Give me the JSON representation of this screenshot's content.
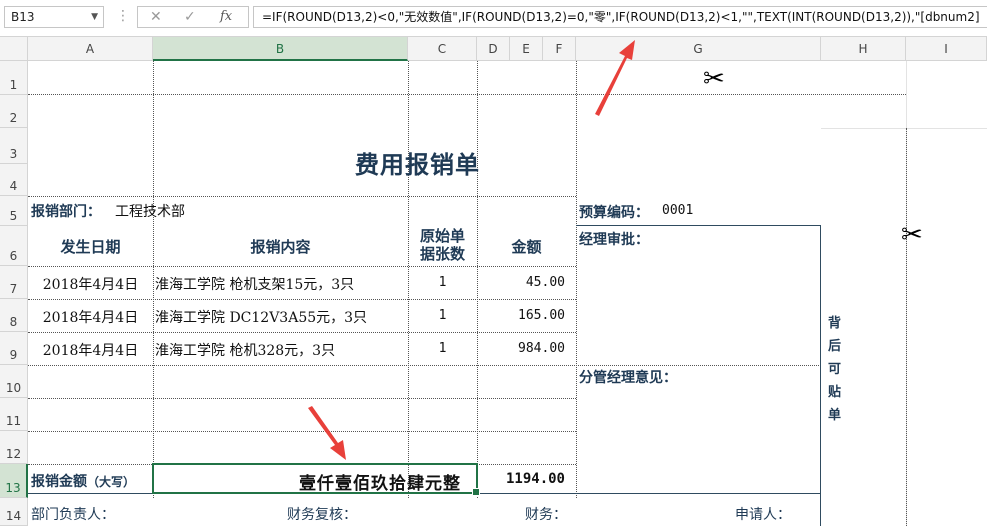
{
  "formula_bar": {
    "name_box": "B13",
    "cancel_icon": "✕",
    "enter_icon": "✓",
    "fx_label": "fx",
    "formula": "=IF(ROUND(D13,2)<0,\"无效数值\",IF(ROUND(D13,2)=0,\"零\",IF(ROUND(D13,2)<1,\"\",TEXT(INT(ROUND(D13,2)),\"[dbnum2]"
  },
  "columns": [
    "A",
    "B",
    "C",
    "D",
    "E",
    "F",
    "G",
    "H",
    "I"
  ],
  "rows": [
    "1",
    "2",
    "3",
    "4",
    "5",
    "6",
    "7",
    "8",
    "9",
    "10",
    "11",
    "12",
    "13",
    "14"
  ],
  "form": {
    "title": "费用报销单",
    "department_label": "报销部门：",
    "department_value": "工程技术部",
    "budget_label": "预算编码：",
    "budget_value": "0001",
    "headers": {
      "date": "发生日期",
      "content": "报销内容",
      "docs_line1": "原始单",
      "docs_line2": "据张数",
      "amount": "金额"
    },
    "items": [
      {
        "date": "2018年4月4日",
        "content": "淮海工学院 枪机支架15元，3只",
        "docs": "1",
        "amount": "45.00"
      },
      {
        "date": "2018年4月4日",
        "content": "淮海工学院 DC12V3A55元，3只",
        "docs": "1",
        "amount": "165.00"
      },
      {
        "date": "2018年4月4日",
        "content": "淮海工学院 枪机328元，3只",
        "docs": "1",
        "amount": "984.00"
      }
    ],
    "manager_approval": "经理审批：",
    "branch_manager_opinion": "分管经理意见：",
    "side_note": [
      "背",
      "后",
      "可",
      "贴",
      "单"
    ],
    "total_label": "报销金额",
    "total_label_suffix": "（大写）",
    "total_chinese": "壹仟壹佰玖拾肆元整",
    "total_amount": "1194.00",
    "footer": {
      "dept_head": "部门负责人：",
      "finance_review": "财务复核：",
      "finance": "财务：",
      "applicant": "申请人："
    }
  },
  "colors": {
    "accent": "#217346",
    "text": "#1f3a55",
    "arrow": "#e8403a"
  }
}
